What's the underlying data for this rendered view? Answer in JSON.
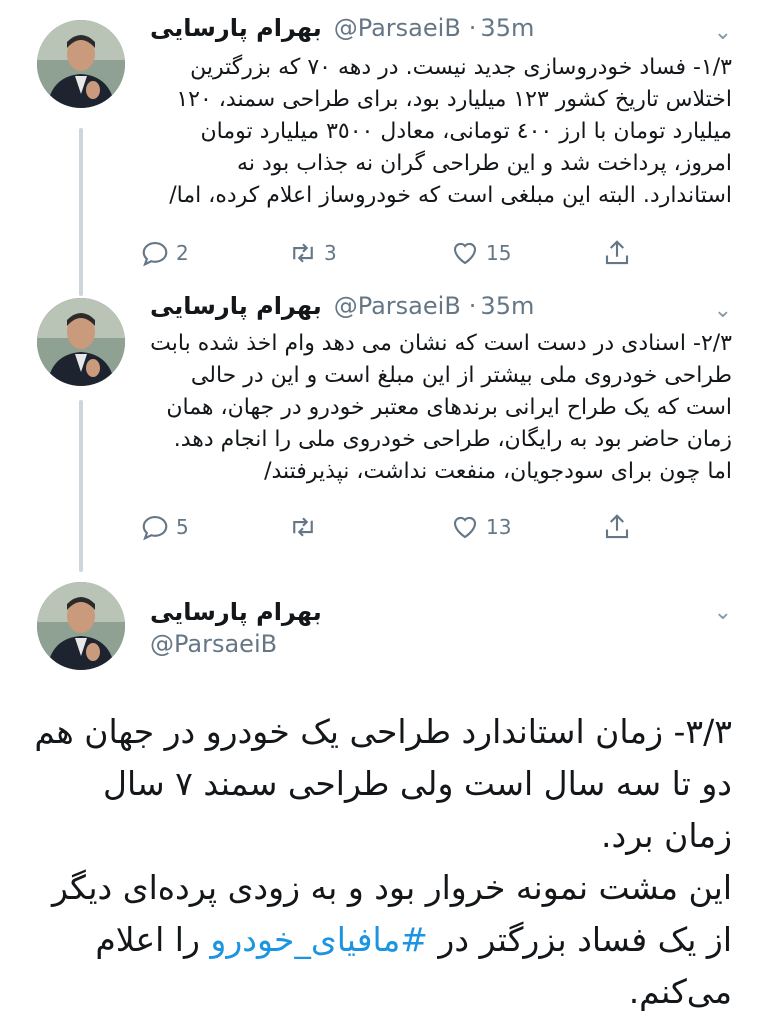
{
  "tweets": [
    {
      "author": "بهرام پارسایی",
      "handle": "@ParsaeiB",
      "time": "35m",
      "text": "١/٣- فساد خودروسازی جدید نیست.  در دهه ٧٠ که بزرگترین اختلاس تاریخ کشور ١٢٣ میلیارد بود، برای طراحی سمند، ١٢٠ میلیارد تومان با ارز ٤٠٠ تومانی، معادل ٣٥٠٠ میلیارد تومان امروز، پرداخت شد و این طراحی گران نه جذاب بود نه استاندارد. البته این مبلغی است که خودروساز اعلام کرده، اما/",
      "replies": "2",
      "retweets": "3",
      "likes": "15"
    },
    {
      "author": "بهرام پارسایی",
      "handle": "@ParsaeiB",
      "time": "35m",
      "text": "٢/٣- اسنادی در دست است که نشان می دهد وام اخذ شده بابت طراحی خودروی ملی بیشتر از این مبلغ است و این در حالی است که یک طراح ایرانی برندهای معتبر خودرو در جهان، همان زمان حاضر بود به رایگان، طراحی خودروی ملی را انجام دهد. اما چون برای سودجویان، منفعت نداشت، نپذیرفتند/",
      "replies": "5",
      "retweets": "",
      "likes": "13"
    },
    {
      "author": "بهرام پارسایی",
      "handle": "@ParsaeiB",
      "text_line1": "٣/٣- زمان استاندارد طراحی یک خودرو در جهان هم دو تا سه سال است ولی طراحی سمند ٧ سال زمان برد.",
      "text_line2_pre": "این مشت نمونه خروار بود و به زودی پرده‌ای دیگر از یک فساد بزرگتر در ",
      "hashtag": "#مافیای_خودرو",
      "text_line2_post": " را اعلام می‌کنم."
    }
  ],
  "icons": {
    "reply": "reply-icon",
    "retweet": "retweet-icon",
    "like": "heart-icon",
    "share": "share-icon",
    "caret": "chevron-down-icon"
  },
  "colors": {
    "text": "#14171a",
    "secondary": "#657786",
    "link": "#1b95e0",
    "thread_line": "#ccd6dd"
  }
}
